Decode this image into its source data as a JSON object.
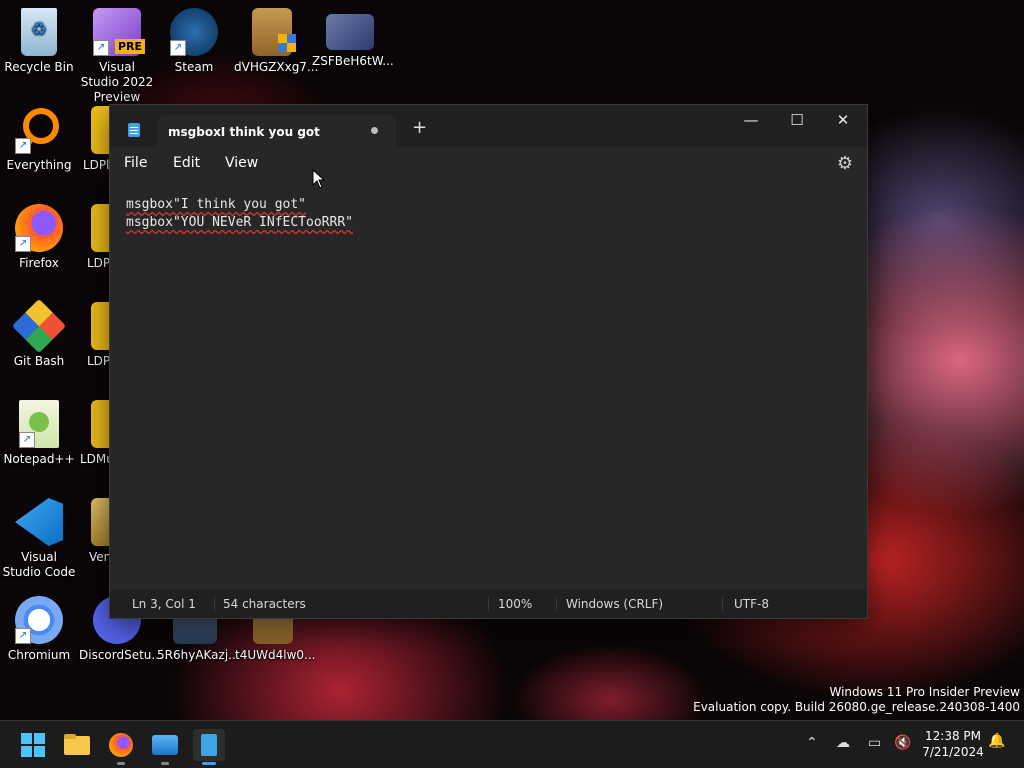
{
  "desktop": {
    "icons": [
      {
        "label": "Recycle Bin",
        "icon": "recycle-bin-icon"
      },
      {
        "label": "Visual Studio 2022 Preview",
        "icon": "visual-studio-icon",
        "badge": "PRE"
      },
      {
        "label": "Steam",
        "icon": "steam-icon"
      },
      {
        "label": "dVHGZXxg7...",
        "icon": "installer-icon"
      },
      {
        "label": "ZSFBeH6tW...",
        "icon": "disc-icon"
      },
      {
        "label": "Everything",
        "icon": "search-icon"
      },
      {
        "label": "LDPl",
        "icon": "ldplayer-icon"
      },
      {
        "label": "Firefox",
        "icon": "firefox-icon"
      },
      {
        "label": "LDP",
        "icon": "ldplayer-icon"
      },
      {
        "label": "Git Bash",
        "icon": "git-icon"
      },
      {
        "label": "LDP",
        "icon": "ldplayer-icon"
      },
      {
        "label": "Notepad++",
        "icon": "notepadpp-icon"
      },
      {
        "label": "LDMu",
        "icon": "ldplayer-icon"
      },
      {
        "label": "Visual Studio Code",
        "icon": "vscode-icon"
      },
      {
        "label": "Ven",
        "icon": "archive-icon"
      },
      {
        "label": "Chromium",
        "icon": "chromium-icon"
      },
      {
        "label": "DiscordSetu...",
        "icon": "discord-icon"
      },
      {
        "label": "5R6hyAKazj...",
        "icon": "installer-icon"
      },
      {
        "label": "t4UWd4lw0...",
        "icon": "installer-icon"
      }
    ]
  },
  "notepad": {
    "tab_title": "msgboxI think you got",
    "menu": [
      "File",
      "Edit",
      "View"
    ],
    "lines": [
      "msgbox\"I think you got\"",
      "msgbox\"YOU NEVeR INfECTooRRR\""
    ],
    "status": {
      "position": "Ln 3, Col 1",
      "characters": "54 characters",
      "zoom": "100%",
      "line_ending": "Windows (CRLF)",
      "encoding": "UTF-8"
    }
  },
  "watermark": {
    "line1": "Windows 11 Pro Insider Preview",
    "line2": "Evaluation copy. Build 26080.ge_release.240308-1400"
  },
  "taskbar": {
    "apps": [
      "start-icon",
      "file-explorer-icon",
      "firefox-icon",
      "photos-icon",
      "notepad-icon"
    ],
    "time": "12:38 PM",
    "date": "7/21/2024"
  }
}
